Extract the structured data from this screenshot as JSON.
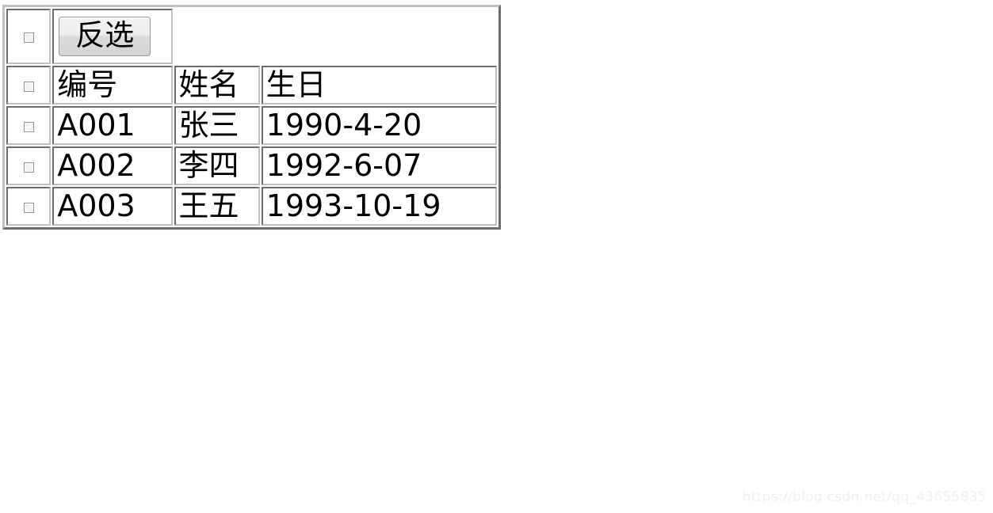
{
  "toolbar": {
    "invert_select_label": "反选",
    "select_all_checkbox_checked": false
  },
  "table": {
    "header_row_checkbox_checked": false,
    "columns": [
      {
        "key": "check",
        "label": ""
      },
      {
        "key": "id",
        "label": "编号"
      },
      {
        "key": "name",
        "label": "姓名"
      },
      {
        "key": "birthday",
        "label": "生日"
      }
    ],
    "rows": [
      {
        "checked": false,
        "id": "A001",
        "name": "张三",
        "birthday": "1990-4-20"
      },
      {
        "checked": false,
        "id": "A002",
        "name": "李四",
        "birthday": "1992-6-07"
      },
      {
        "checked": false,
        "id": "A003",
        "name": "王五",
        "birthday": "1993-10-19"
      }
    ]
  },
  "watermark": {
    "text": "https://blog.csdn.net/qq_43655835"
  },
  "colors": {
    "page_background": "#ffffff",
    "table_border": "#c0c0c0",
    "cell_border": "#c0c0c0",
    "text": "#000000",
    "button_face": "#ededed",
    "watermark_text": "#f0f0f0"
  }
}
